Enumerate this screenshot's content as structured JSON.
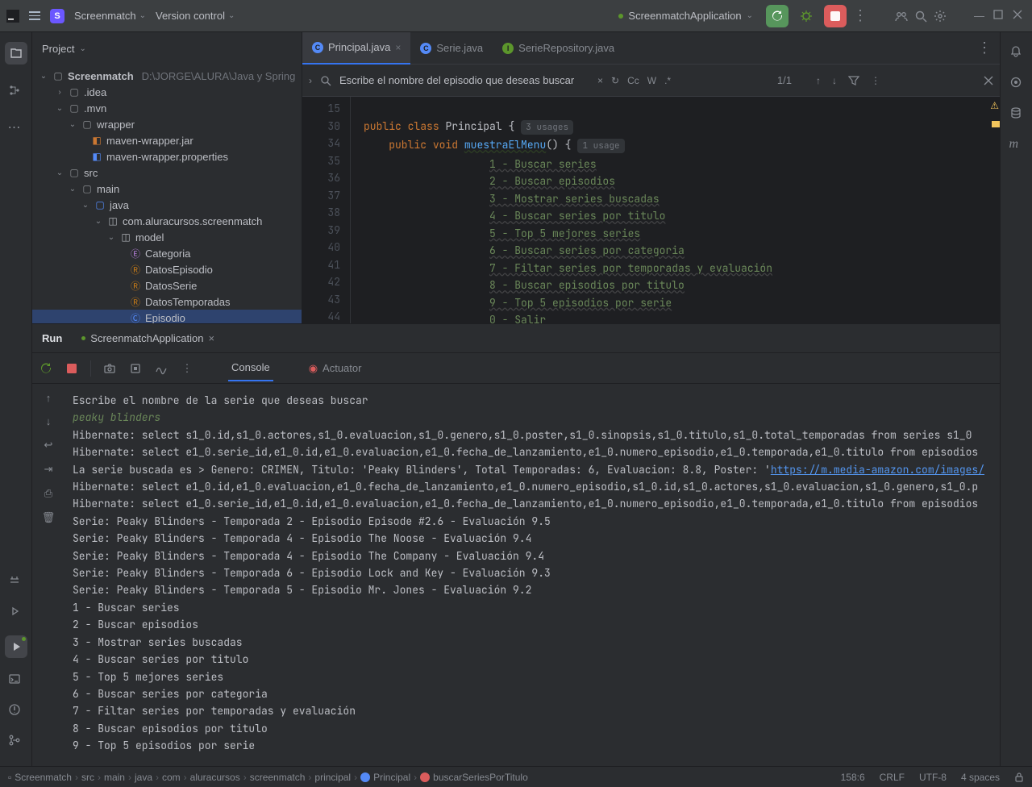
{
  "titlebar": {
    "project": "Screenmatch",
    "menu_vcs": "Version control",
    "run_config": "ScreenmatchApplication"
  },
  "project_panel": {
    "title": "Project",
    "root_name": "Screenmatch",
    "root_path": "D:\\JORGE\\ALURA\\Java y Spring",
    "nodes": {
      "idea": ".idea",
      "mvn": ".mvn",
      "wrapper": "wrapper",
      "wrapperjar": "maven-wrapper.jar",
      "wrapperprops": "maven-wrapper.properties",
      "src": "src",
      "main": "main",
      "java": "java",
      "pkg": "com.aluracursos.screenmatch",
      "model": "model",
      "categoria": "Categoria",
      "datosep": "DatosEpisodio",
      "datosserie": "DatosSerie",
      "datostemp": "DatosTemporadas",
      "episodio": "Episodio"
    }
  },
  "editor": {
    "tabs": [
      "Principal.java",
      "Serie.java",
      "SerieRepository.java"
    ],
    "find": {
      "placeholder": "Escribe el nombre del episodio que deseas buscar",
      "count": "1/1",
      "cc": "Cc",
      "w": "W",
      "re": ".*"
    },
    "lines": [
      "15",
      "30",
      "34",
      "35",
      "36",
      "37",
      "38",
      "39",
      "40",
      "41",
      "42",
      "43",
      "44"
    ],
    "code": {
      "l1_kw1": "public",
      "l1_kw2": "class",
      "l1_cls": "Principal ",
      "l1_brace": "{",
      "l1_hint": "3 usages",
      "l2_kw1": "public",
      "l2_kw2": "void",
      "l2_mth": "muestraElMenu",
      "l2_par": "() {",
      "l2_hint": "1 usage",
      "m1": "1 - Buscar series",
      "m2": "2 - Buscar episodios",
      "m3": "3 - Mostrar series buscadas",
      "m4": "4 - Buscar series por titulo",
      "m5": "5 - Top 5 mejores series",
      "m6": "6 - Buscar series por categoria",
      "m7": "7 - Filtar series por temporadas y evaluación",
      "m8": "8 - Buscar episodios por titulo",
      "m9": "9 - Top 5 episodios por serie",
      "m0": "0 - Salir",
      "mend": "\"\"\";"
    }
  },
  "run": {
    "title": "Run",
    "config": "ScreenmatchApplication",
    "tab_console": "Console",
    "tab_actuator": "Actuator"
  },
  "console": {
    "l1": "Escribe el nombre de la serie que deseas buscar",
    "l2": "peaky blinders",
    "l3": "Hibernate: select s1_0.id,s1_0.actores,s1_0.evaluacion,s1_0.genero,s1_0.poster,s1_0.sinopsis,s1_0.titulo,s1_0.total_temporadas from series s1_0",
    "l4": "Hibernate: select e1_0.serie_id,e1_0.id,e1_0.evaluacion,e1_0.fecha_de_lanzamiento,e1_0.numero_episodio,e1_0.temporada,e1_0.titulo from episodios",
    "l5a": "La serie buscada es > Genero: CRIMEN, Titulo: 'Peaky Blinders', Total Temporadas: 6, Evaluacion: 8.8, Poster: '",
    "l5b": "https://m.media-amazon.com/images/",
    "l6": "Hibernate: select e1_0.id,e1_0.evaluacion,e1_0.fecha_de_lanzamiento,e1_0.numero_episodio,s1_0.id,s1_0.actores,s1_0.evaluacion,s1_0.genero,s1_0.p",
    "l7": "Hibernate: select e1_0.serie_id,e1_0.id,e1_0.evaluacion,e1_0.fecha_de_lanzamiento,e1_0.numero_episodio,e1_0.temporada,e1_0.titulo from episodios",
    "l8": "Serie: Peaky Blinders - Temporada 2 - Episodio Episode #2.6 - Evaluación 9.5",
    "l9": "Serie: Peaky Blinders - Temporada 4 - Episodio The Noose - Evaluación 9.4",
    "l10": "Serie: Peaky Blinders - Temporada 4 - Episodio The Company - Evaluación 9.4",
    "l11": "Serie: Peaky Blinders - Temporada 6 - Episodio Lock and Key - Evaluación 9.3",
    "l12": "Serie: Peaky Blinders - Temporada 5 - Episodio Mr. Jones - Evaluación 9.2",
    "l13": "1 - Buscar series",
    "l14": "2 - Buscar episodios",
    "l15": "3 - Mostrar series buscadas",
    "l16": "4 - Buscar series por titulo",
    "l17": "5 - Top 5 mejores series",
    "l18": "6 - Buscar series por categoria",
    "l19": "7 - Filtar series por temporadas y evaluación",
    "l20": "8 - Buscar episodios por titulo",
    "l21": "9 - Top 5 episodios por serie"
  },
  "breadcrumbs": [
    "Screenmatch",
    "src",
    "main",
    "java",
    "com",
    "aluracursos",
    "screenmatch",
    "principal",
    "Principal",
    "buscarSeriesPorTitulo"
  ],
  "status": {
    "pos": "158:6",
    "lf": "CRLF",
    "enc": "UTF-8",
    "indent": "4 spaces"
  }
}
